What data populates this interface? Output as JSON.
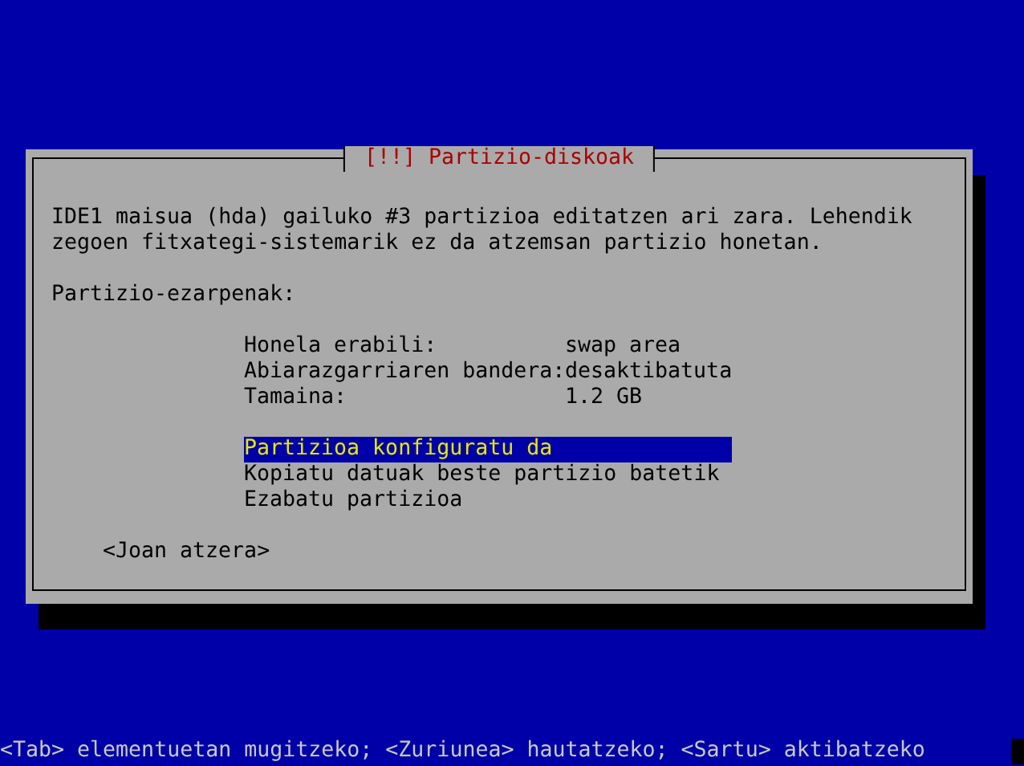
{
  "dialog": {
    "title": "[!!] Partizio-diskoak",
    "message": "IDE1 maisua (hda) gailuko #3 partizioa editatzen ari zara. Lehendik zegoen fitxategi-sistemarik ez da atzemsan partizio honetan.",
    "settings_heading": "Partizio-ezarpenak:",
    "settings": [
      {
        "label": "Honela erabili:",
        "value": "swap area"
      },
      {
        "label": "Abiarazgarriaren bandera:",
        "value": "desaktibatuta"
      },
      {
        "label": "Tamaina:",
        "value": "1.2 GB"
      }
    ],
    "actions": [
      {
        "label": "Partizioa konfiguratu da",
        "selected": true
      },
      {
        "label": "Kopiatu datuak beste partizio batetik",
        "selected": false
      },
      {
        "label": "Ezabatu partizioa",
        "selected": false
      }
    ],
    "back_button": "<Joan atzera>"
  },
  "help_line": "<Tab> elementuetan mugitzeko; <Zuriunea> hautatzeko; <Sartu> aktibatzeko"
}
